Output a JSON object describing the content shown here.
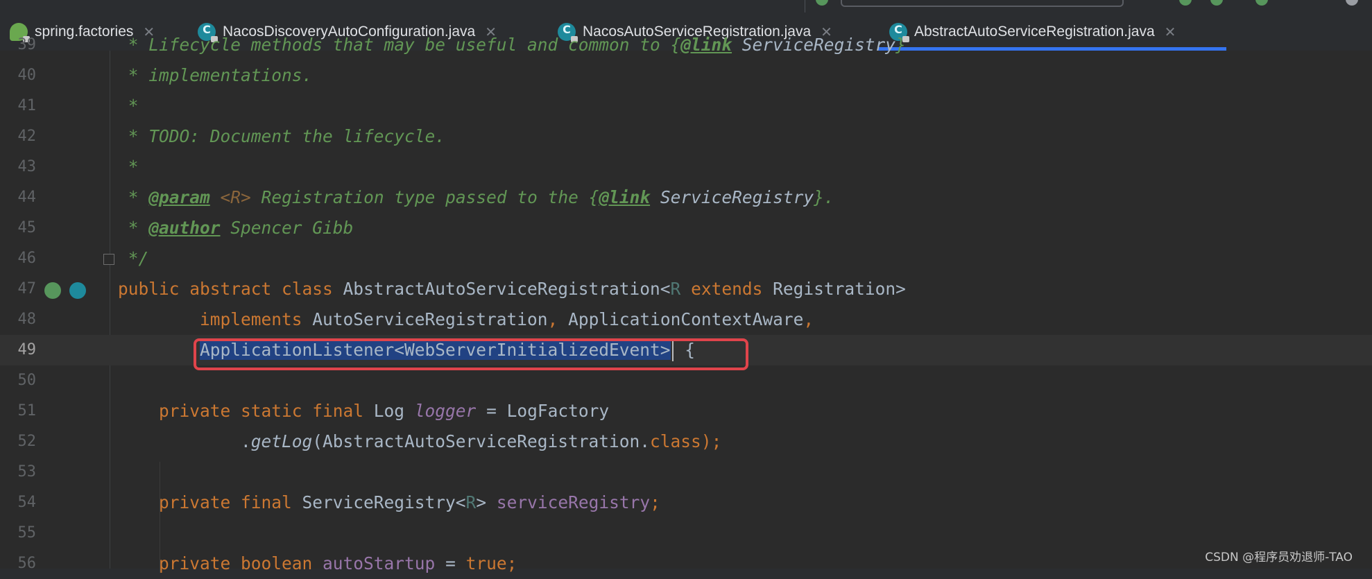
{
  "tabs": [
    {
      "label": "spring.factories",
      "icon": "spring-icon",
      "active": false
    },
    {
      "label": "NacosDiscoveryAutoConfiguration.java",
      "icon": "java-class-icon",
      "active": false
    },
    {
      "label": "NacosAutoServiceRegistration.java",
      "icon": "java-class-icon",
      "active": false
    },
    {
      "label": "AbstractAutoServiceRegistration.java",
      "icon": "java-class-icon",
      "active": true
    }
  ],
  "close_glyph": "✕",
  "editor": {
    "current_line": "49",
    "lines": [
      {
        "num": "39",
        "text": " * Lifecycle methods that may be useful and common to {@link ServiceRegistry}"
      },
      {
        "num": "40",
        "text": " * implementations."
      },
      {
        "num": "41",
        "text": " *"
      },
      {
        "num": "42",
        "text": " * TODO: Document the lifecycle."
      },
      {
        "num": "43",
        "text": " *"
      },
      {
        "num": "44",
        "text": " * @param <R> Registration type passed to the {@link ServiceRegistry}."
      },
      {
        "num": "45",
        "text": " * @author Spencer Gibb"
      },
      {
        "num": "46",
        "text": " */"
      },
      {
        "num": "47",
        "text": "public abstract class AbstractAutoServiceRegistration<R extends Registration>"
      },
      {
        "num": "48",
        "text": "        implements AutoServiceRegistration, ApplicationContextAware,"
      },
      {
        "num": "49",
        "text": "        ApplicationListener<WebServerInitializedEvent> {"
      },
      {
        "num": "50",
        "text": ""
      },
      {
        "num": "51",
        "text": "    private static final Log logger = LogFactory"
      },
      {
        "num": "52",
        "text": "            .getLog(AbstractAutoServiceRegistration.class);"
      },
      {
        "num": "53",
        "text": ""
      },
      {
        "num": "54",
        "text": "    private final ServiceRegistry<R> serviceRegistry;"
      },
      {
        "num": "55",
        "text": ""
      },
      {
        "num": "56",
        "text": "    private boolean autoStartup = true;"
      }
    ]
  },
  "highlight_color": "#e0444b",
  "watermark": "CSDN @程序员劝退师-TAO"
}
